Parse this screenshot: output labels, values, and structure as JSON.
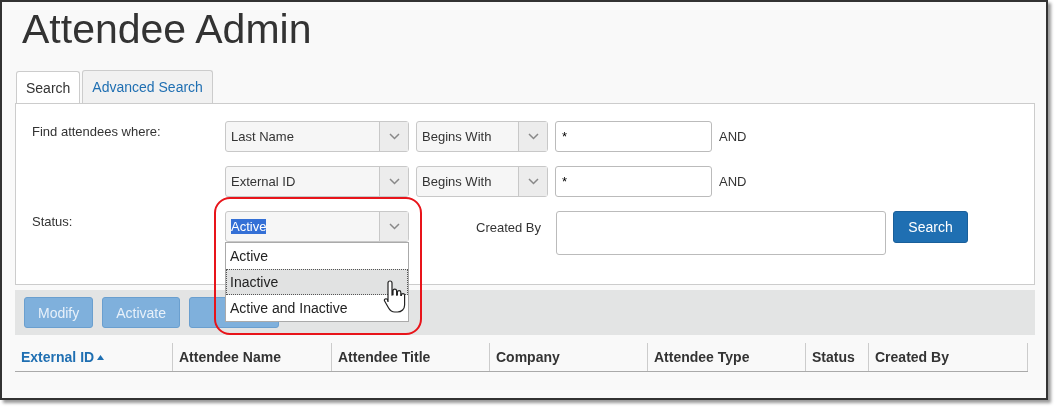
{
  "title": "Attendee Admin",
  "tabs": [
    {
      "label": "Search",
      "selected": true
    },
    {
      "label": "Advanced Search",
      "selected": false
    }
  ],
  "form": {
    "find_label": "Find attendees where:",
    "criteria": [
      {
        "field": "Last Name",
        "operator": "Begins With",
        "value": "*",
        "conjunction": "AND"
      },
      {
        "field": "External ID",
        "operator": "Begins With",
        "value": "*",
        "conjunction": "AND"
      }
    ],
    "status": {
      "label": "Status:",
      "value": "Active",
      "expanded": true,
      "options": [
        {
          "label": "Active",
          "highlighted": false
        },
        {
          "label": "Inactive",
          "highlighted": true
        },
        {
          "label": "Active and Inactive",
          "highlighted": false
        }
      ]
    },
    "created_by": {
      "label": "Created By"
    },
    "search_button": "Search"
  },
  "toolbar": [
    {
      "label": "Modify",
      "disabled": true
    },
    {
      "label": "Activate",
      "disabled": true
    },
    {
      "disabled": true
    }
  ],
  "table": {
    "columns": [
      {
        "label": "External ID",
        "sorted": true
      },
      {
        "label": "Attendee Name",
        "sorted": false
      },
      {
        "label": "Attendee Title",
        "sorted": false
      },
      {
        "label": "Company",
        "sorted": false
      },
      {
        "label": "Attendee Type",
        "sorted": false
      },
      {
        "label": "Status",
        "sorted": false
      },
      {
        "label": "Created By",
        "sorted": false
      }
    ]
  }
}
